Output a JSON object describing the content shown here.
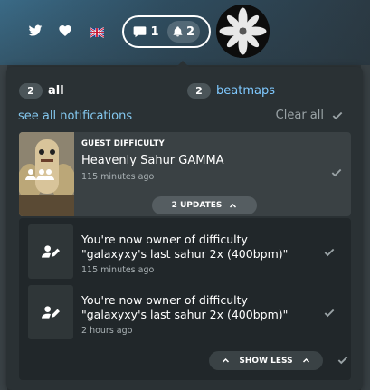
{
  "topbar": {
    "icons": [
      "twitter-icon",
      "heart-icon",
      "uk-flag-icon"
    ],
    "chat_count": "1",
    "notification_count": "2"
  },
  "filters": {
    "all_count": "2",
    "all_label": "all",
    "beatmaps_count": "2",
    "beatmaps_label": "beatmaps"
  },
  "actions": {
    "see_all": "see all notifications",
    "clear_all": "Clear all"
  },
  "group": {
    "type": "GUEST DIFFICULTY",
    "title": "Heavenly Sahur GAMMA",
    "time": "115 minutes ago",
    "updates_button": "2 UPDATES"
  },
  "items": [
    {
      "text_line1": "You're now owner of difficulty",
      "text_line2": "\"galaxyxy's last sahur 2x (400bpm)\"",
      "time": "115 minutes ago"
    },
    {
      "text_line1": "You're now owner of difficulty",
      "text_line2": "\"galaxyxy's last sahur 2x (400bpm)\"",
      "time": "2 hours ago"
    }
  ],
  "show_less": "SHOW LESS",
  "colors": {
    "accent_link": "#84c8ef",
    "panel_bg": "#2a3134",
    "card_bg": "#3a4144"
  }
}
